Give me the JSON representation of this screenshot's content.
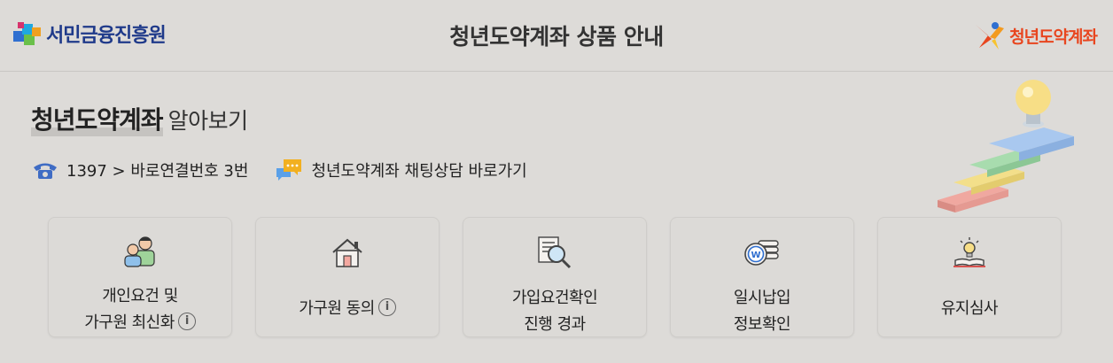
{
  "header": {
    "left_logo_text": "서민금융진흥원",
    "title": "청년도약계좌 상품 안내",
    "right_logo_text": "청년도약계좌"
  },
  "section": {
    "title_strong": "청년도약계좌",
    "title_sub": "알아보기"
  },
  "contact": {
    "phone_text": "1397 > 바로연결번호 3번",
    "chat_text": "청년도약계좌 채팅상담 바로가기"
  },
  "cards": [
    {
      "line1": "개인요건 및",
      "line2": "가구원 최신화",
      "info": true,
      "icon": "family-icon"
    },
    {
      "line1": "가구원 동의",
      "line2": "",
      "info": true,
      "icon": "house-icon"
    },
    {
      "line1": "가입요건확인",
      "line2": "진행 경과",
      "info": false,
      "icon": "document-search-icon"
    },
    {
      "line1": "일시납입",
      "line2": "정보확인",
      "info": false,
      "icon": "coin-stack-icon"
    },
    {
      "line1": "유지심사",
      "line2": "",
      "info": false,
      "icon": "lightbulb-book-icon"
    }
  ],
  "colors": {
    "background": "#dddbd8",
    "brand_blue": "#1f3a8a",
    "brand_orange": "#e8461f"
  }
}
